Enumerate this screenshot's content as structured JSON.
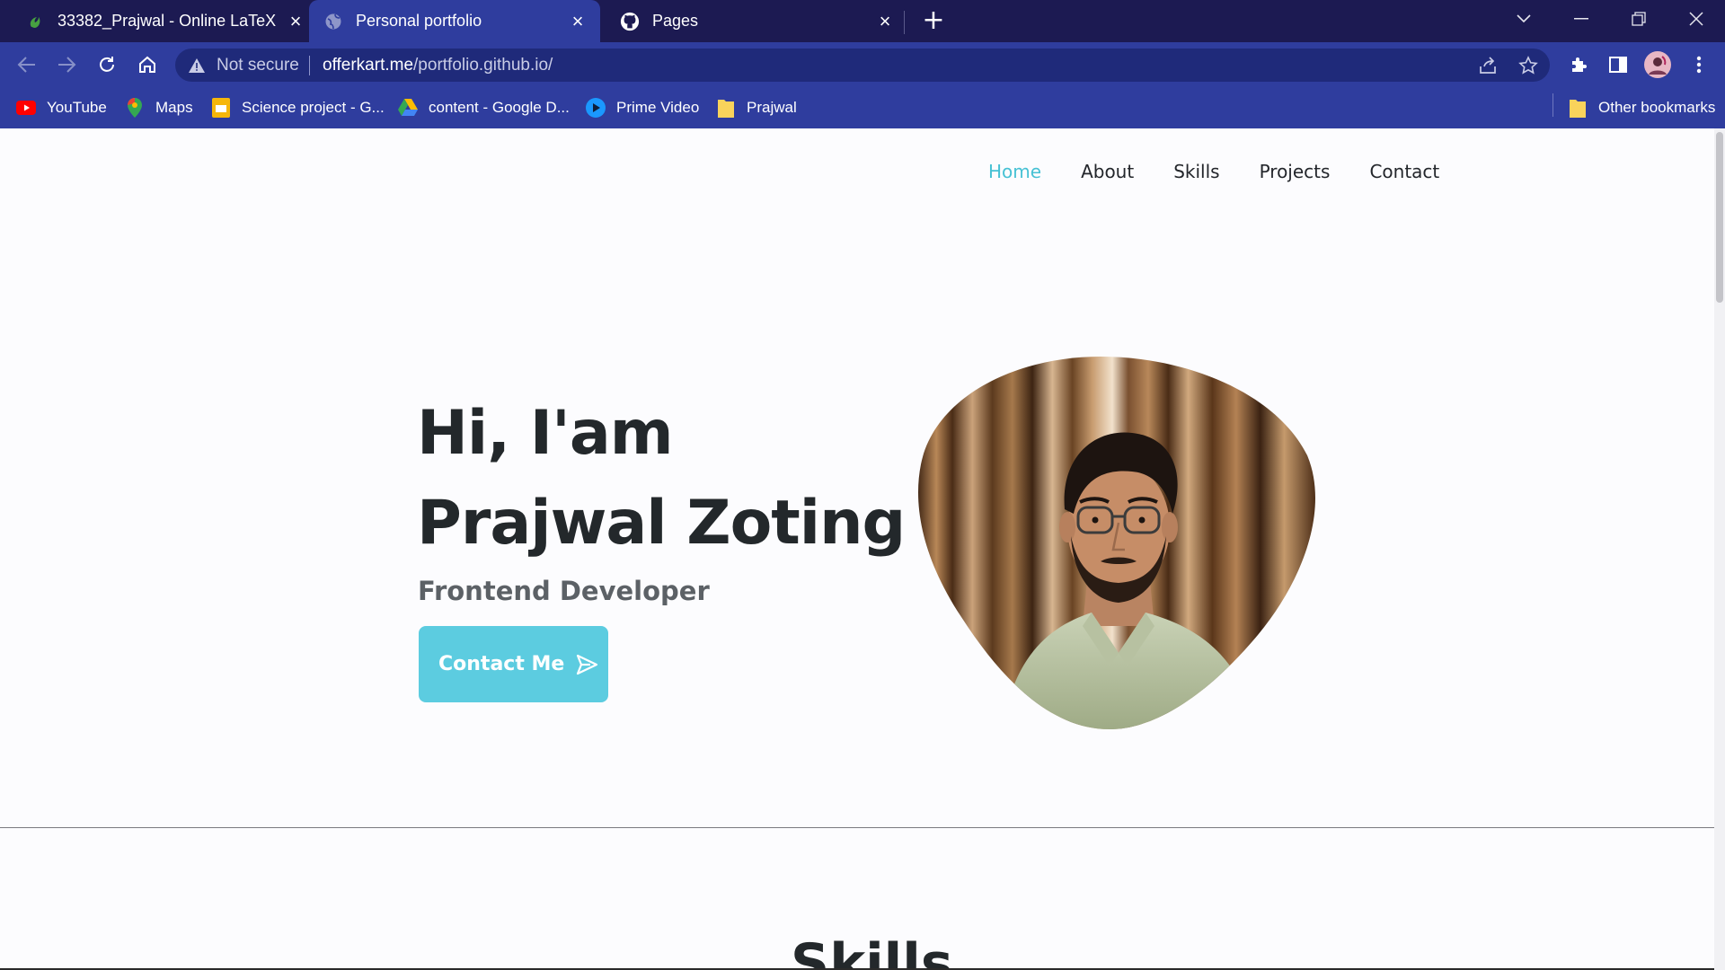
{
  "browser": {
    "tabs": [
      {
        "title": "33382_Prajwal - Online LaTeX Editor",
        "icon": "overleaf-icon"
      },
      {
        "title": "Personal portfolio",
        "icon": "globe-icon",
        "active": true
      },
      {
        "title": "Pages",
        "icon": "github-icon"
      }
    ],
    "address": {
      "security_label": "Not secure",
      "url_host": "offerkart.me",
      "url_path": "/portfolio.github.io/"
    },
    "bookmarks": [
      {
        "label": "YouTube",
        "icon": "youtube-icon"
      },
      {
        "label": "Maps",
        "icon": "maps-icon"
      },
      {
        "label": "Science project - G...",
        "icon": "slides-icon"
      },
      {
        "label": "content - Google D...",
        "icon": "drive-icon"
      },
      {
        "label": "Prime Video",
        "icon": "prime-video-icon"
      },
      {
        "label": "Prajwal",
        "icon": "folder-icon"
      }
    ],
    "other_bookmarks": "Other bookmarks"
  },
  "site": {
    "nav": [
      {
        "label": "Home",
        "active": true
      },
      {
        "label": "About"
      },
      {
        "label": "Skills"
      },
      {
        "label": "Projects"
      },
      {
        "label": "Contact"
      }
    ],
    "hero": {
      "greeting": "Hi, I'am",
      "name": "Prajwal Zoting",
      "role": "Frontend Developer",
      "cta_label": "Contact Me"
    },
    "next_section_title": "Skills"
  },
  "colors": {
    "tabbar": "#1c1a52",
    "toolbar": "#2f3d9e",
    "accent": "#46c1d4",
    "button": "#5ccce0",
    "text_dark": "#23282b"
  }
}
